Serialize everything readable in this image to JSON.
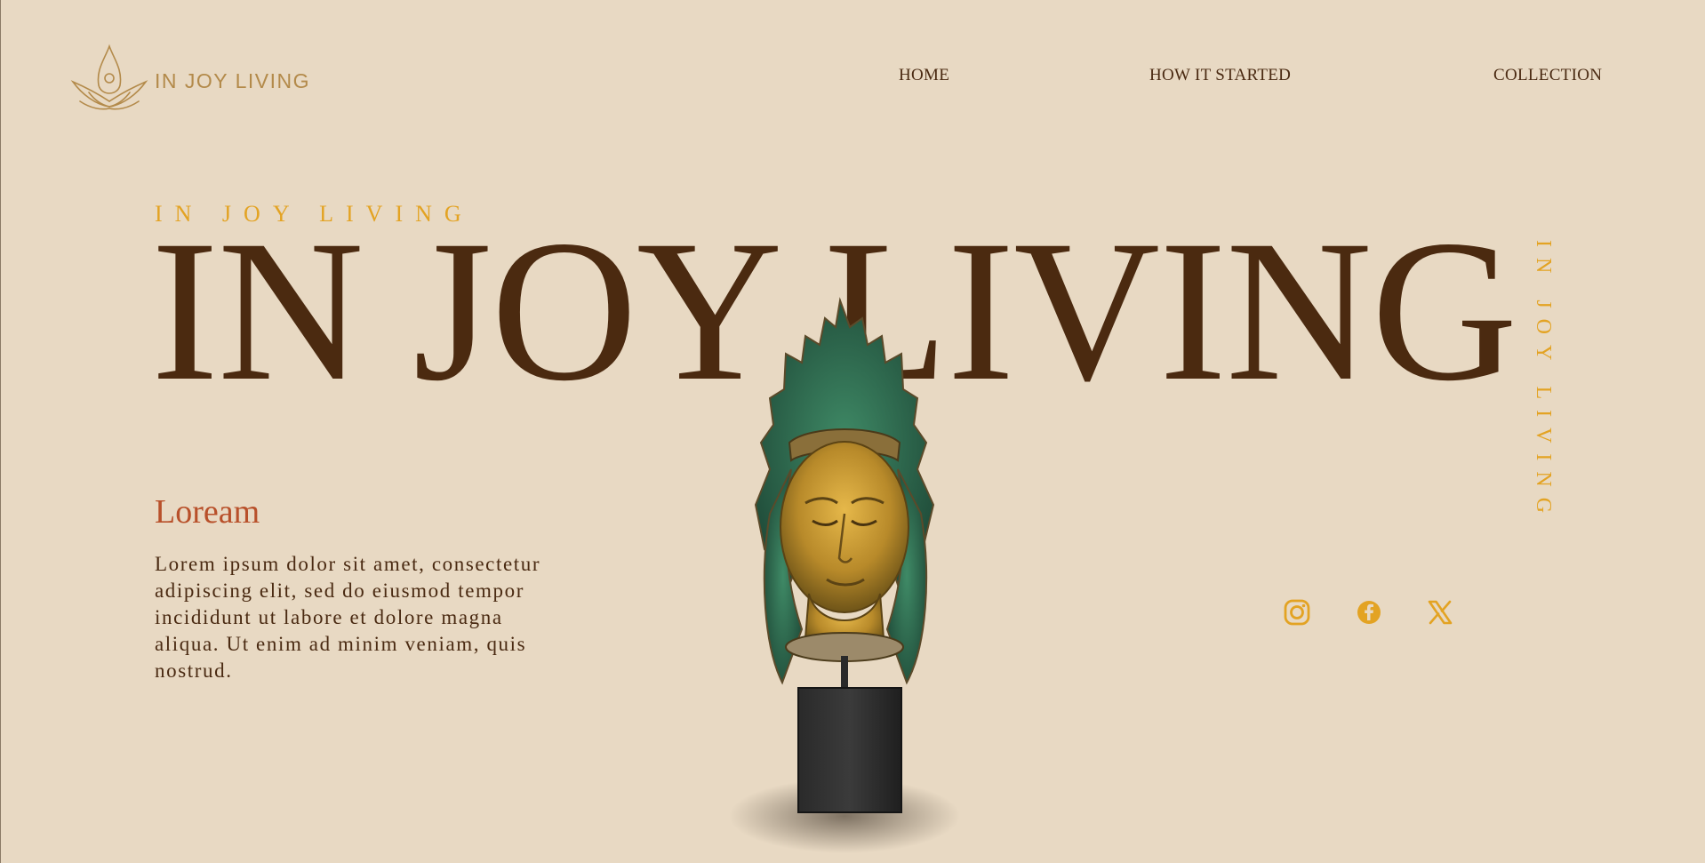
{
  "header": {
    "logo_text": "IN JOY LIVING",
    "nav": [
      {
        "label": "HOME"
      },
      {
        "label": "HOW IT STARTED"
      },
      {
        "label": "COLLECTION"
      }
    ]
  },
  "hero": {
    "eyebrow": "IN JOY LIVING",
    "title": "IN JOY LIVING",
    "vertical_text": "IN JOY LIVING",
    "sub_heading": "Loream",
    "body": "Lorem ipsum dolor sit amet, consectetur adipiscing elit, sed do eiusmod tempor incididunt ut labore et dolore magna aliqua. Ut enim ad minim veniam, quis nostrud."
  },
  "social": {
    "icons": [
      "instagram-icon",
      "facebook-icon",
      "x-icon"
    ],
    "color": "#e3a323"
  },
  "colors": {
    "background": "#e8d9c3",
    "title_brown": "#4b2a10",
    "accent_gold": "#e3a323",
    "accent_rust": "#b8502a",
    "logo_gold": "#b38a4a"
  }
}
